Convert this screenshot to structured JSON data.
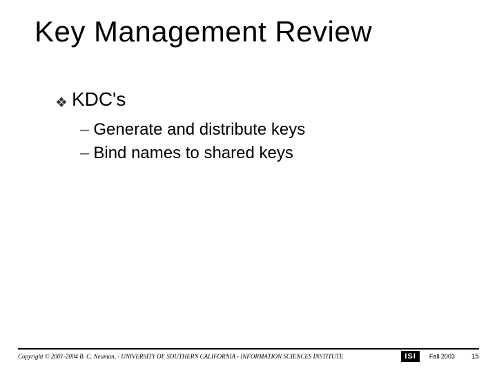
{
  "title": "Key Management Review",
  "bullets": [
    {
      "label": "KDC's",
      "marker": "❖",
      "subbullets": [
        {
          "marker": "–",
          "text": "Generate and distribute keys"
        },
        {
          "marker": "–",
          "text": "Bind names to shared keys"
        }
      ]
    }
  ],
  "footer": {
    "copyright": "Copyright © 2001-2004  B. C. Neuman, - UNIVERSITY OF SOUTHERN CALIFORNIA - INFORMATION SCIENCES INSTITUTE",
    "logo_text": "ISI",
    "term": "Fall 2003",
    "page": "15"
  }
}
